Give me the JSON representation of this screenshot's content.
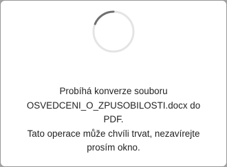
{
  "dialog": {
    "spinner_icon": "loading-spinner-icon",
    "message_lines": [
      "Probíhá konverze souboru",
      "OSVEDCENI_O_ZPUSOBILOSTI.docx do",
      "PDF.",
      "Tato operace může chvíli trvat, nezavírejte",
      "prosím okno."
    ]
  },
  "colors": {
    "spinner_track": "#e4e4e4",
    "spinner_arc": "#6f6f6f",
    "text": "#222222",
    "backdrop": "#a3a3a3"
  }
}
